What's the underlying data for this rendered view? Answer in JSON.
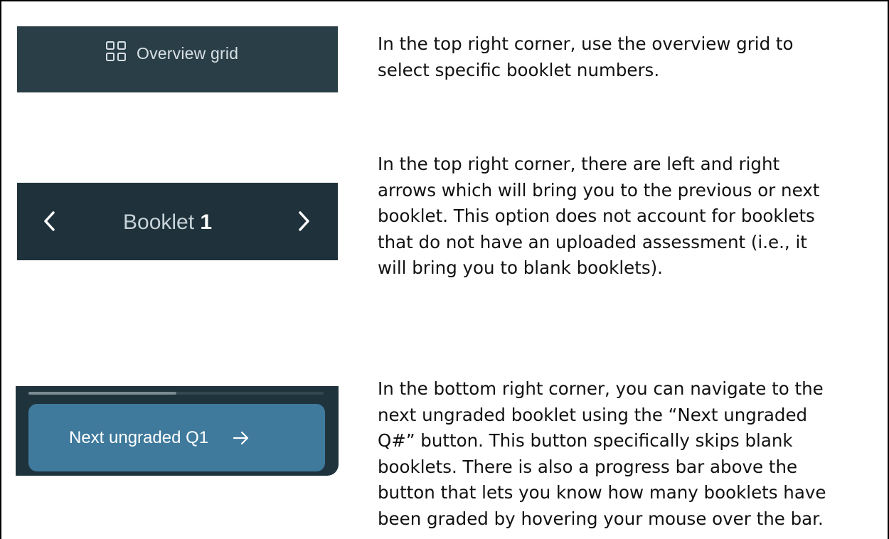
{
  "rows": [
    {
      "screenshot": {
        "label": "Overview grid",
        "icon": "grid-icon"
      },
      "description": "In the top right corner, use the overview grid to\nselect specific booklet numbers."
    },
    {
      "screenshot": {
        "label_prefix": "Booklet ",
        "number": "1",
        "left_icon": "chevron-left-icon",
        "right_icon": "chevron-right-icon"
      },
      "description": "In the top right corner, there are left and right\narrows which will bring you to the previous or next\nbooklet. This option does not account for booklets\nthat do not have an uploaded assessment (i.e., it\nwill bring you to blank booklets)."
    },
    {
      "screenshot": {
        "label": "Next ungraded Q1",
        "icon": "arrow-right-icon",
        "progress_fraction": 0.5
      },
      "description": "In the bottom right corner, you can navigate to the\nnext ungraded booklet using the “Next ungraded\nQ#” button. This button specifically skips blank\nbooklets. There is also a progress bar above the\nbutton that lets you know how many booklets have\nbeen graded by hovering your mouse over the bar."
    }
  ],
  "colors": {
    "overview_bg": "#2a3e47",
    "booklet_bg": "#1f323c",
    "next_panel_bg": "#1f333d",
    "next_button_bg": "#3f7a9d",
    "progress_fill": "#7a8b92",
    "progress_track": "#33474f"
  }
}
